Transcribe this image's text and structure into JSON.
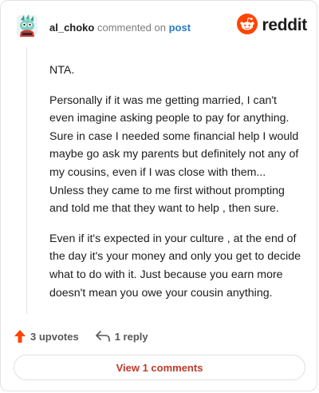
{
  "header": {
    "username": "al_choko",
    "action_text": "commented on",
    "post_link": "post",
    "brand": "reddit"
  },
  "comment": {
    "paragraphs": [
      "NTA.",
      "Personally if it was me getting married, I can't even imagine asking people to pay for anything. Sure in case I needed some financial help I would maybe go ask my parents but definitely not any of my cousins, even if I was close with them... Unless they came to me first without prompting and told me that they want to help , then sure.",
      "Even if it's expected in your culture , at the end of the day it's your money and only you get to decide what to do with it. Just because you earn more doesn't mean you owe your cousin anything."
    ]
  },
  "actions": {
    "upvotes": "3 upvotes",
    "replies": "1 reply",
    "view_comments": "View 1 comments"
  },
  "colors": {
    "upvote": "#ff4500",
    "brand_orange": "#ff4500",
    "link": "#2c7bbf",
    "view_button_text": "#c0392b"
  },
  "icons": {
    "avatar": "snoo-avatar",
    "brand": "reddit-logo-icon",
    "upvote": "upvote-arrow-icon",
    "reply": "reply-arrow-icon"
  }
}
